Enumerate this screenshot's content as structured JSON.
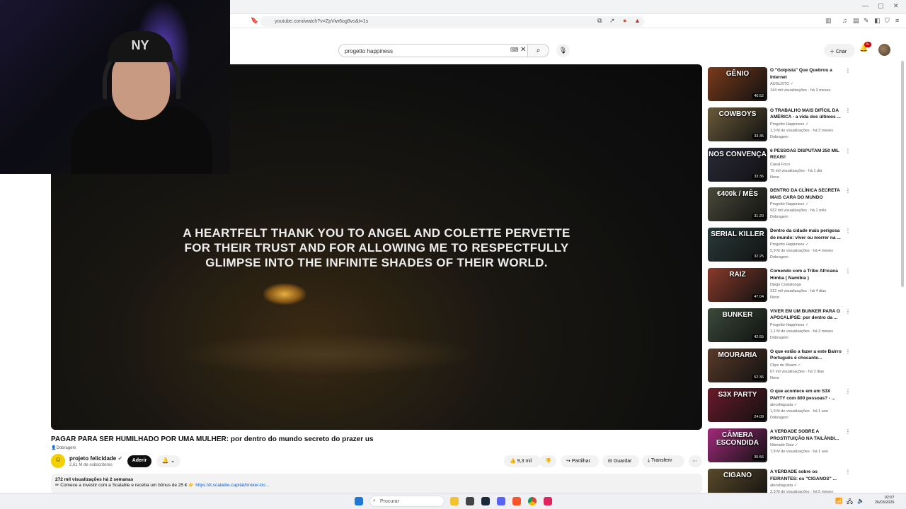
{
  "browser": {
    "url": "youtube.com/watch?v=ZpViw6og8vo&t=1s",
    "window_controls": [
      "—",
      "▢",
      "✕"
    ]
  },
  "youtube": {
    "search_value": "progetto happiness",
    "create_label": "Criar",
    "notif_count": "9+"
  },
  "video": {
    "caption_lines": [
      "A HEARTFELT THANK YOU TO ANGEL AND COLETTE PERVETTE",
      "FOR THEIR TRUST AND FOR ALLOWING ME TO RESPECTFULLY",
      "GLIMPSE INTO THE INFINITE SHADES OF THEIR WORLD."
    ],
    "title": "PAGAR PARA SER HUMILHADO POR UMA MULHER: por dentro do mundo secreto do prazer us",
    "dub_label": "Dobragem",
    "channel": "projeto felicidade",
    "subscribers": "2,61 M de subscritores",
    "join_label": "Aderir",
    "likes": "9,3 mil",
    "share_label": "Partilhar",
    "save_label": "Guardar",
    "download_label": "Transferir",
    "views_date": "272 mil visualizações  há 2 semanas",
    "desc_line": "✏ Comece a investir com a Scalable e receba um bônus de 25 € 👉",
    "desc_link": "https://it.scalable.capital/broker-bo..."
  },
  "recommendations": [
    {
      "title": "O \"Golpista\" Que Quebrou a Internet",
      "channel": "AUGUSTO ✓",
      "meta": "144 mil visualizações · há 3 meses",
      "badge": "",
      "duration": "40:52",
      "thumb_text": "GÊNIO",
      "thumb_bg": "#7a3a1a"
    },
    {
      "title": "O TRABALHO MAIS DIFÍCIL DA AMÉRICA - a vida dos últimos ...",
      "channel": "Progetto Happiness ✓",
      "meta": "1,3 M de visualizações · há 3 meses",
      "badge": "Dobragem",
      "duration": "33:35",
      "thumb_text": "COWBOYS",
      "thumb_bg": "#6a5a3a"
    },
    {
      "title": "6 PESSOAS DISPUTAM 250 MIL REAIS!",
      "channel": "Canal Foco",
      "meta": "75 mil visualizações · há 1 dia",
      "badge": "Novo",
      "duration": "33:36",
      "thumb_text": "NOS CONVENÇA",
      "thumb_bg": "#2a2a3a"
    },
    {
      "title": "DENTRO DA CLÍNICA SECRETA MAIS CARA DO MUNDO",
      "channel": "Progetto Happiness ✓",
      "meta": "932 mil visualizações · há 1 mês",
      "badge": "Dobragem",
      "duration": "31:20",
      "thumb_text": "€400k / MÊS",
      "thumb_bg": "#4a4a3a"
    },
    {
      "title": "Dentro da cidade mais perigosa do mundo: viver ou morrer na ...",
      "channel": "Progetto Happiness ✓",
      "meta": "5,9 M de visualizações · há 4 meses",
      "badge": "Dobragem",
      "duration": "32:25",
      "thumb_text": "SERIAL KILLER",
      "thumb_bg": "#2a3a3a"
    },
    {
      "title": "Comendo com a Tribo Africana Himba ( Namíbia )",
      "channel": "Diego Costalonga",
      "meta": "312 mil visualizações · há 4 dias",
      "badge": "Novo",
      "duration": "47:04",
      "thumb_text": "RAIZ",
      "thumb_bg": "#8a3a2a"
    },
    {
      "title": "VIVER EM UM BUNKER PARA O APOCALIPSE: por dentro da ...",
      "channel": "Progetto Happiness ✓",
      "meta": "1,1 M de visualizações · há 3 meses",
      "badge": "Dobragem",
      "duration": "42:55",
      "thumb_text": "BUNKER",
      "thumb_bg": "#3a4a3a"
    },
    {
      "title": "O que estão a fazer a este Bairro Português é chocante...",
      "channel": "Clips do Wuant ✓",
      "meta": "67 mil visualizações · há 3 dias",
      "badge": "Novo",
      "duration": "52:36",
      "thumb_text": "MOURARIA",
      "thumb_bg": "#5a3a2a"
    },
    {
      "title": "O que acontece em um S3X PARTY com 800 pessoas? - ...",
      "channel": "alecellagusta ✓",
      "meta": "1,9 M de visualizações · há 1 ano",
      "badge": "Dobragem",
      "duration": "24:09",
      "thumb_text": "S3X PARTY",
      "thumb_bg": "#6a1a2a"
    },
    {
      "title": "A VERDADE SOBRE A PROSTITUIÇÃO NA TAILÂNDI...",
      "channel": "Nômade Raiz ✓",
      "meta": "7,8 M de visualizações · há 1 ano",
      "badge": "",
      "duration": "35:56",
      "thumb_text": "CÂMERA ESCONDIDA",
      "thumb_bg": "#a02a7a"
    },
    {
      "title": "A VERDADE sobre os FEIRANTES: os \"CIGANOS\" ...",
      "channel": "alecellagusta ✓",
      "meta": "2,3 M de visualizações · há 5 meses",
      "badge": "Dobragem",
      "duration": "27:30",
      "thumb_text": "CIGANO",
      "thumb_bg": "#5a4a2a"
    }
  ],
  "taskbar": {
    "search_placeholder": "Procurar",
    "time": "02:07",
    "date": "26/03/2026"
  },
  "webcam": {
    "cap_text": "NY"
  }
}
